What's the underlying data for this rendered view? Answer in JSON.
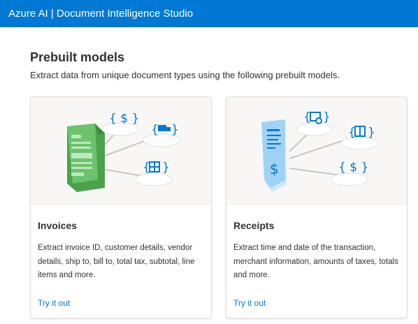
{
  "header": {
    "title": "Azure AI | Document Intelligence Studio"
  },
  "section": {
    "title": "Prebuilt models",
    "subtitle": "Extract data from unique document types using the following prebuilt models."
  },
  "cards": [
    {
      "title": "Invoices",
      "description": "Extract invoice ID, customer details, vendor details, ship to, bill to, total tax, subtotal, line items and more.",
      "link": "Try it out",
      "illustration": "invoice-document-illustration"
    },
    {
      "title": "Receipts",
      "description": "Extract time and date of the transaction, merchant information, amounts of taxes, totals and more.",
      "link": "Try it out",
      "illustration": "receipt-document-illustration"
    }
  ],
  "colors": {
    "header_bg": "#0078d4",
    "link": "#0078d4",
    "invoice_green": "#5cb85c",
    "receipt_blue": "#8cc8f0",
    "icon_blue": "#0078d4"
  }
}
